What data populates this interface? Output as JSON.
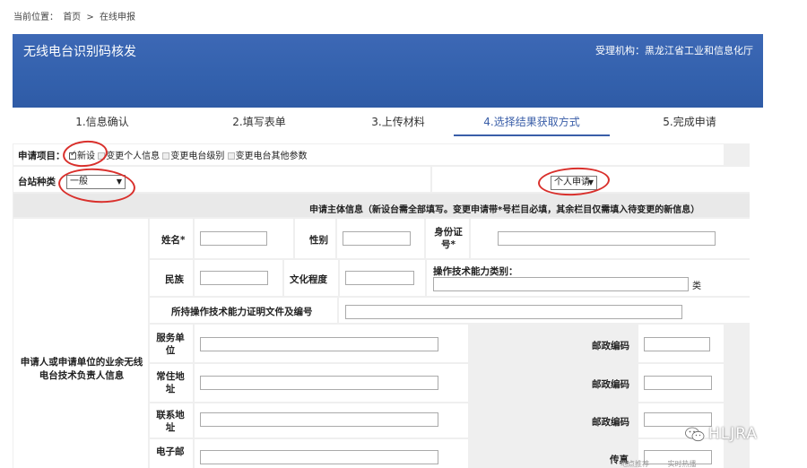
{
  "breadcrumb": {
    "label": "当前位置：",
    "home": "首页",
    "sep": ">",
    "current": "在线申报"
  },
  "banner": {
    "title": "无线电台识别码核发",
    "org": "受理机构：黑龙江省工业和信息化厅"
  },
  "steps": [
    "1.信息确认",
    "2.填写表单",
    "3.上传材料",
    "4.选择结果获取方式",
    "5.完成申请"
  ],
  "form": {
    "project_label": "申请项目：",
    "options": [
      "新设",
      "变更个人信息",
      "变更电台级别",
      "变更电台其他参数"
    ],
    "station_type_label": "台站种类",
    "station_type_value": "一般",
    "apply_type_value": "个人申请",
    "section_title": "申请主体信息（新设台需全部填写。变更申请带*号栏目必填，其余栏目仅需填入待变更的新信息）",
    "side_label": "申请人或申请单位的业余无线电台技术负责人信息",
    "name_label": "姓名*",
    "gender_label": "性别",
    "id_label": "身份证号*",
    "ethnic_label": "民族",
    "education_label": "文化程度",
    "skill_label": "操作技术能力类别：",
    "skill_suffix": "类",
    "cert_label": "所持操作技术能力证明文件及编号",
    "work_label": "服务单位",
    "postal_label": "邮政编码",
    "address_label": "常住地址",
    "contact_label": "联系地址",
    "email_label": "电子邮",
    "fax_label": "传真"
  },
  "watermark": {
    "text": "HLJRA",
    "icon": "wechat-icon"
  },
  "bottom": {
    "left": "地点推荐",
    "right": "实时热播"
  }
}
